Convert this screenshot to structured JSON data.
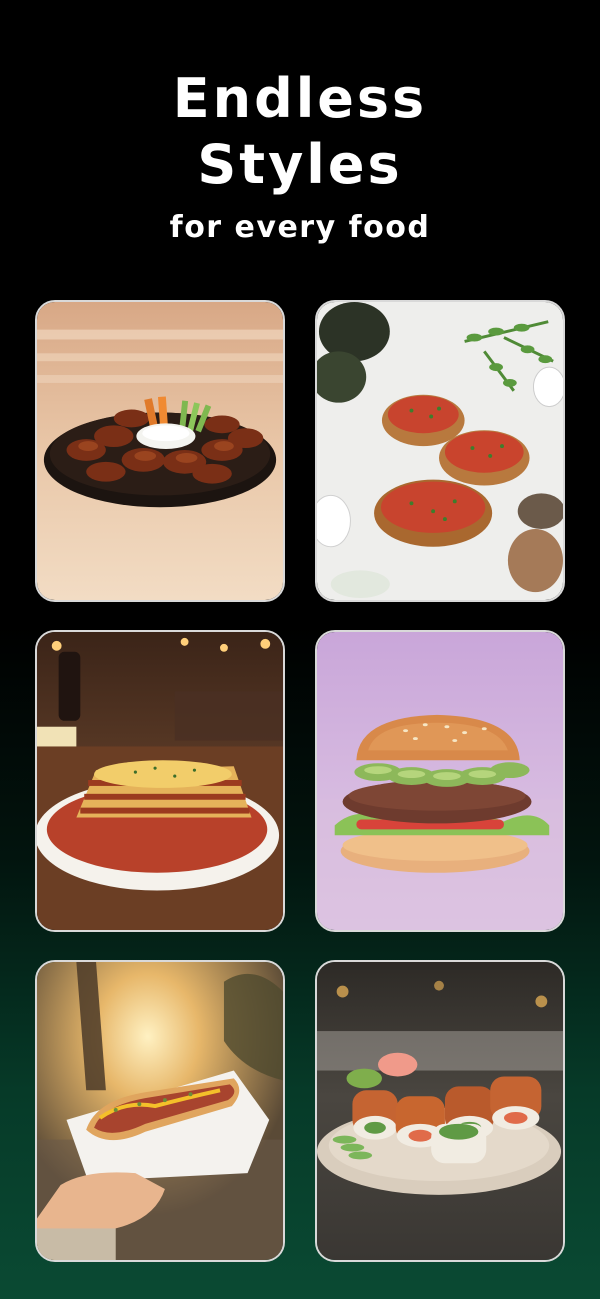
{
  "header": {
    "title_line1": "Endless",
    "title_line2": "Styles",
    "subtitle": "for every food"
  },
  "gallery": {
    "items": [
      {
        "icon": "chicken-wings-platter-image"
      },
      {
        "icon": "bruschetta-image"
      },
      {
        "icon": "lasagna-image"
      },
      {
        "icon": "burger-image"
      },
      {
        "icon": "hot-dog-image"
      },
      {
        "icon": "sushi-rolls-image"
      }
    ]
  },
  "colors": {
    "background_top": "#000000",
    "background_bottom": "#0a4a33",
    "text": "#ffffff",
    "tile_border": "#d9d9d9"
  }
}
